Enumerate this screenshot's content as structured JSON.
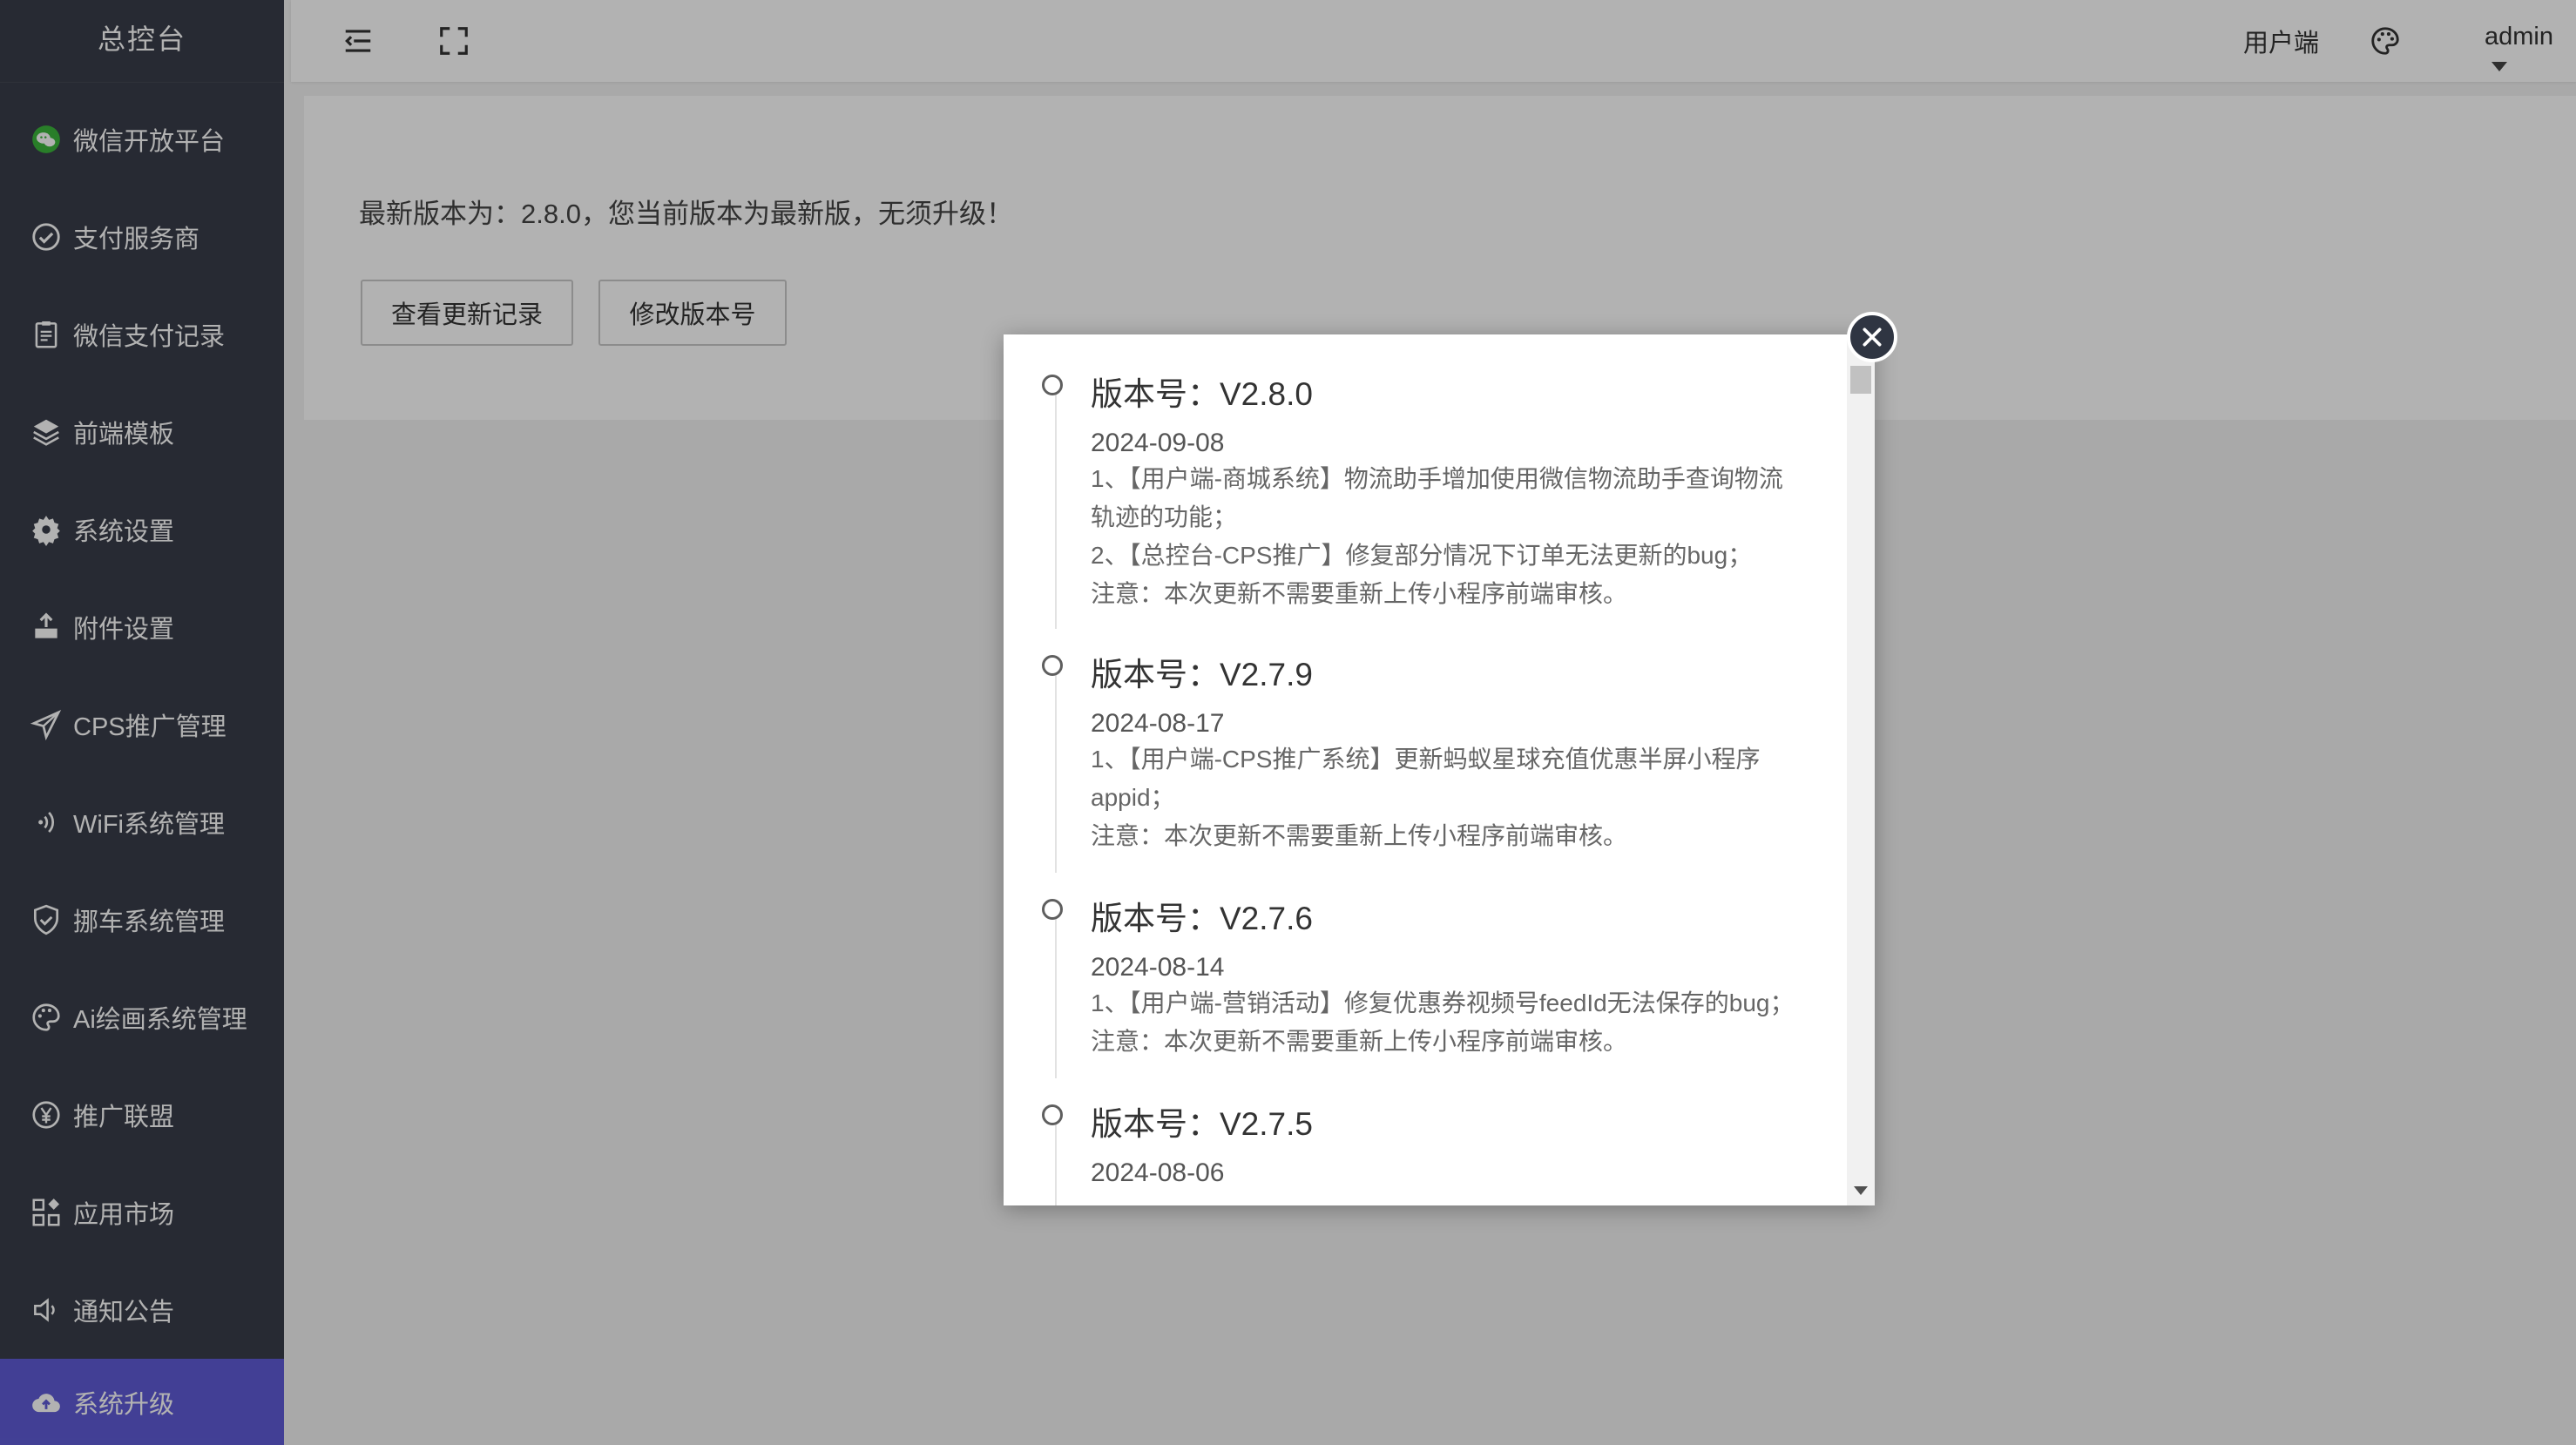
{
  "sidebar": {
    "title": "总控台",
    "items": [
      {
        "label": "微信开放平台",
        "icon": "wechat-icon"
      },
      {
        "label": "支付服务商",
        "icon": "check-circle-icon"
      },
      {
        "label": "微信支付记录",
        "icon": "clipboard-icon"
      },
      {
        "label": "前端模板",
        "icon": "layers-icon"
      },
      {
        "label": "系统设置",
        "icon": "gear-icon"
      },
      {
        "label": "附件设置",
        "icon": "upload-icon"
      },
      {
        "label": "CPS推广管理",
        "icon": "paper-plane-icon"
      },
      {
        "label": "WiFi系统管理",
        "icon": "wifi-icon"
      },
      {
        "label": "挪车系统管理",
        "icon": "shield-check-icon"
      },
      {
        "label": "Ai绘画系统管理",
        "icon": "palette-icon"
      },
      {
        "label": "推广联盟",
        "icon": "yen-icon"
      },
      {
        "label": "应用市场",
        "icon": "apps-icon"
      },
      {
        "label": "通知公告",
        "icon": "speaker-icon"
      },
      {
        "label": "系统升级",
        "icon": "cloud-upload-icon"
      }
    ],
    "active_index": 13
  },
  "header": {
    "user_side_label": "用户端",
    "username": "admin"
  },
  "page": {
    "notice": "最新版本为：2.8.0，您当前版本为最新版，无须升级！",
    "view_log_button": "查看更新记录",
    "edit_version_button": "修改版本号"
  },
  "modal": {
    "entries": [
      {
        "title": "版本号：V2.8.0",
        "date": "2024-09-08",
        "lines": [
          "1、【用户端-商城系统】物流助手增加使用微信物流助手查询物流",
          "轨迹的功能；",
          "2、【总控台-CPS推广】修复部分情况下订单无法更新的bug；",
          "注意：本次更新不需要重新上传小程序前端审核。"
        ]
      },
      {
        "title": "版本号：V2.7.9",
        "date": "2024-08-17",
        "lines": [
          "1、【用户端-CPS推广系统】更新蚂蚁星球充值优惠半屏小程序",
          "appid；",
          "注意：本次更新不需要重新上传小程序前端审核。"
        ]
      },
      {
        "title": "版本号：V2.7.6",
        "date": "2024-08-14",
        "lines": [
          "1、【用户端-营销活动】修复优惠券视频号feedId无法保存的bug；",
          "注意：本次更新不需要重新上传小程序前端审核。"
        ]
      },
      {
        "title": "版本号：V2.7.5",
        "date": "2024-08-06",
        "lines": []
      }
    ]
  }
}
